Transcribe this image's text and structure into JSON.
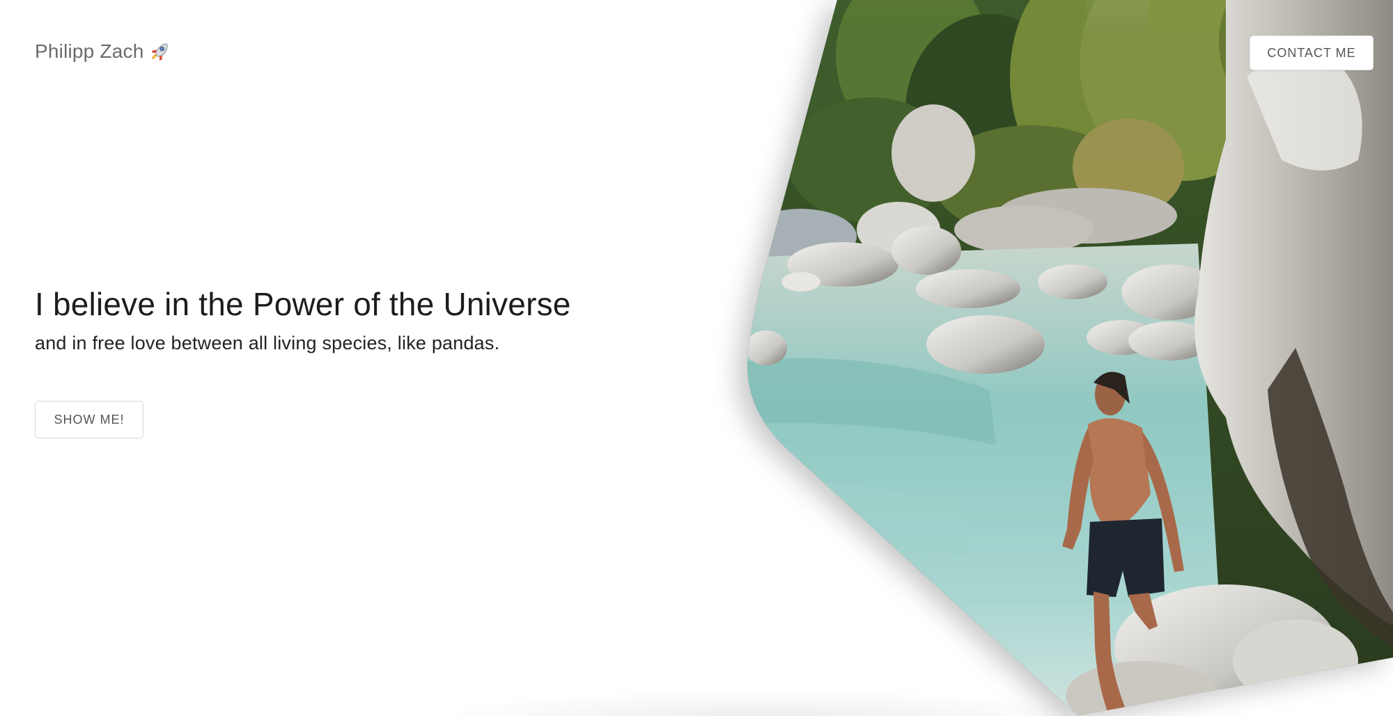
{
  "header": {
    "brand_name": "Philipp Zach",
    "brand_emoji_icon": "rocket-icon",
    "contact_label": "CONTACT ME"
  },
  "hero": {
    "title": "I believe in the Power of the Universe",
    "subtitle": "and in free love between all living species, like pandas.",
    "cta_label": "SHOW ME!"
  },
  "colors": {
    "background": "#ffffff",
    "title_text": "#1c1c1c",
    "brand_text": "#6b6b6b",
    "button_text": "#555555",
    "button_border": "#d6d6d6",
    "water": "#8fc8c2",
    "rock": "#d6d6d2",
    "forest": "#4f6b2e"
  },
  "hero_image": {
    "subject": "man-walking-on-river-rocks-photo"
  }
}
